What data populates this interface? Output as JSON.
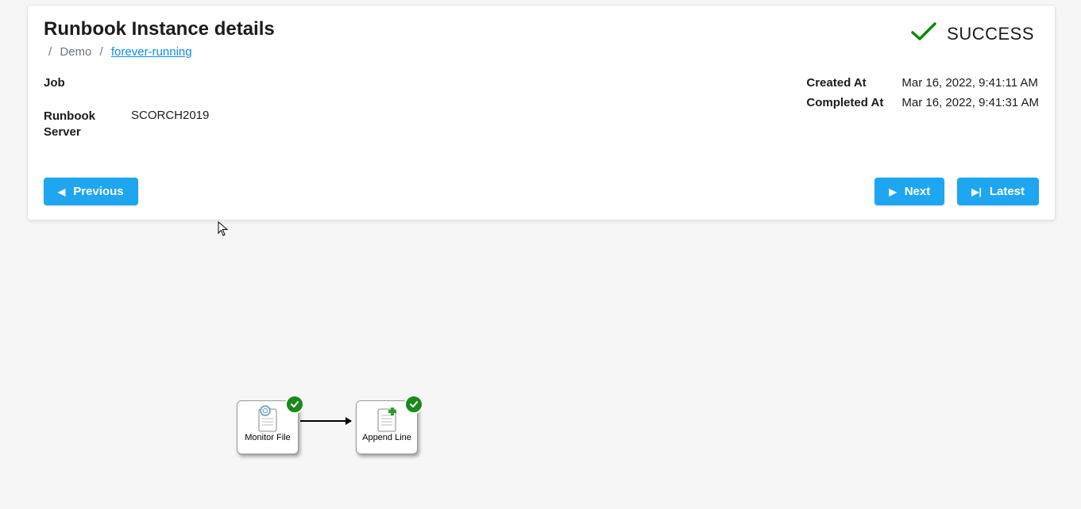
{
  "header": {
    "title": "Runbook Instance details",
    "breadcrumb": {
      "sep": "/",
      "demo": "Demo",
      "link": "forever-running"
    },
    "status": {
      "label": "SUCCESS"
    }
  },
  "details": {
    "job_label": "Job",
    "job_value": "",
    "server_label": "Runbook Server",
    "server_value": "SCORCH2019",
    "created_label": "Created At",
    "created_value": "Mar 16, 2022, 9:41:11 AM",
    "completed_label": "Completed At",
    "completed_value": "Mar 16, 2022, 9:41:31 AM"
  },
  "buttons": {
    "previous": "Previous",
    "next": "Next",
    "latest": "Latest"
  },
  "diagram": {
    "node1": {
      "label": "Monitor File"
    },
    "node2": {
      "label": "Append Line"
    }
  }
}
